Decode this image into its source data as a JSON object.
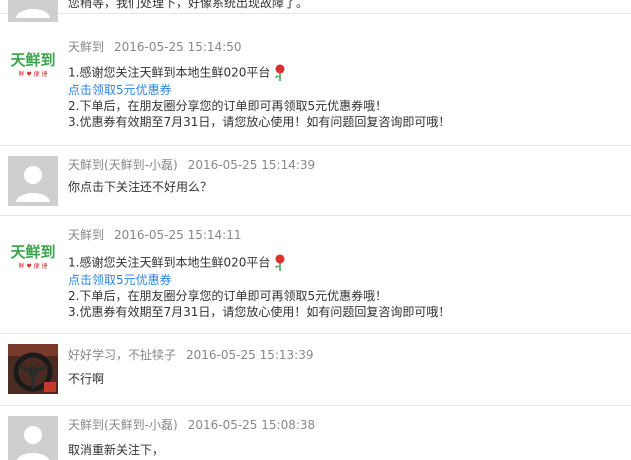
{
  "messages": [
    {
      "id": "m0",
      "text": "您稍等，我们处理下，好像系统出现故障了。"
    },
    {
      "id": "m1",
      "sender": "天鲜到",
      "time": "2016-05-25 15:14:50",
      "line1": "1.感谢您关注天鲜到本地生鲜020平台",
      "link": "点击领取5元优惠券",
      "line2": "2.下单后，在朋友圈分享您的订单即可再领取5元优惠券哦！",
      "line3": "3.优惠券有效期至7月31日，请您放心使用！如有问题回复咨询即可哦！",
      "logo_text": "天鲜到",
      "logo_sub": "鲜 ♥ 便 捷"
    },
    {
      "id": "m2",
      "sender": "天鲜到(天鲜到-小磊)",
      "time": "2016-05-25 15:14:39",
      "text": "你点击下关注还不好用么？"
    },
    {
      "id": "m3",
      "sender": "天鲜到",
      "time": "2016-05-25 15:14:11",
      "line1": "1.感谢您关注天鲜到本地生鲜020平台",
      "link": "点击领取5元优惠券",
      "line2": "2.下单后，在朋友圈分享您的订单即可再领取5元优惠券哦！",
      "line3": "3.优惠券有效期至7月31日，请您放心使用！如有问题回复咨询即可哦！",
      "logo_text": "天鲜到",
      "logo_sub": "鲜 ♥ 便 捷"
    },
    {
      "id": "m4",
      "sender": "好好学习，不扯犊子",
      "time": "2016-05-25 15:13:39",
      "text": "不行啊"
    },
    {
      "id": "m5",
      "sender": "天鲜到(天鲜到-小磊)",
      "time": "2016-05-25 15:08:38",
      "text": "取消重新关注下，"
    }
  ],
  "colors": {
    "link": "#2e86de",
    "meta": "#888888",
    "text": "#333333",
    "divider": "#e6e6e6",
    "logo_green": "#3aa34a",
    "flower": "#d93030"
  }
}
